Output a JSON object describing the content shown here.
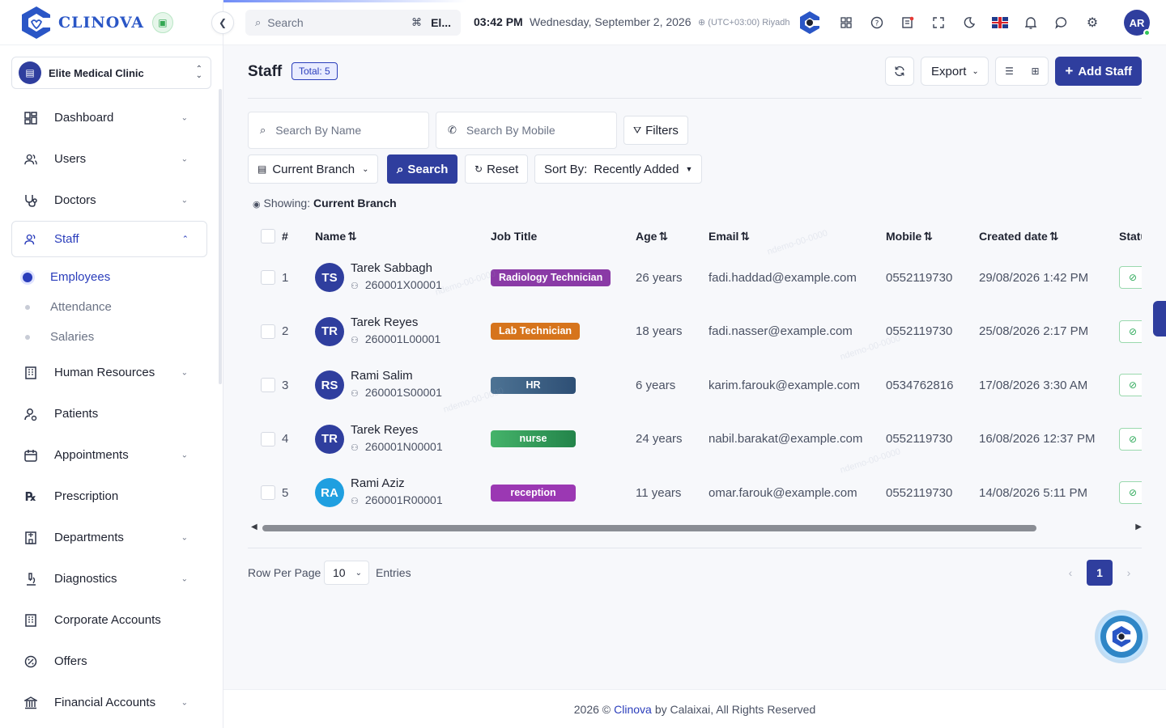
{
  "brand": {
    "name": "CLINOVA",
    "accent": "#2f3e9e"
  },
  "clinic": {
    "name": "Elite Medical Clinic"
  },
  "sidebar": {
    "items": [
      {
        "label": "Dashboard",
        "icon": "dashboard-icon",
        "chevron": true
      },
      {
        "label": "Users",
        "icon": "users-icon",
        "chevron": true
      },
      {
        "label": "Doctors",
        "icon": "stethoscope-icon",
        "chevron": true
      },
      {
        "label": "Staff",
        "icon": "staff-icon",
        "chevron": true,
        "active": true
      }
    ],
    "staff_sub": [
      "Employees",
      "Attendance",
      "Salaries"
    ],
    "items_after": [
      {
        "label": "Human Resources",
        "icon": "building-icon",
        "chevron": true
      },
      {
        "label": "Patients",
        "icon": "patient-icon",
        "chevron": false
      },
      {
        "label": "Appointments",
        "icon": "calendar-icon",
        "chevron": true
      },
      {
        "label": "Prescription",
        "icon": "prescription-icon",
        "chevron": false
      },
      {
        "label": "Departments",
        "icon": "department-icon",
        "chevron": true
      },
      {
        "label": "Diagnostics",
        "icon": "microscope-icon",
        "chevron": true
      },
      {
        "label": "Corporate Accounts",
        "icon": "corporate-icon",
        "chevron": false
      },
      {
        "label": "Offers",
        "icon": "offer-icon",
        "chevron": false
      },
      {
        "label": "Financial Accounts",
        "icon": "bank-icon",
        "chevron": true
      }
    ]
  },
  "topbar": {
    "search_placeholder": "Search",
    "shortcut": "⌘",
    "clinic_abbr": "El...",
    "time": "03:42 PM",
    "date": "Wednesday, September 2, 2026",
    "timezone": "(UTC+03:00) Riyadh",
    "user_initials": "AR"
  },
  "page": {
    "title": "Staff",
    "total": "Total: 5",
    "export_label": "Export",
    "add_label": "Add Staff"
  },
  "filters": {
    "name_placeholder": "Search By Name",
    "mobile_placeholder": "Search By Mobile",
    "filters_label": "Filters",
    "branch_label": "Current Branch",
    "search_label": "Search",
    "reset_label": "Reset",
    "sort_prefix": "Sort By:",
    "sort_value": "Recently Added",
    "showing_prefix": "Showing:",
    "showing_value": "Current Branch"
  },
  "table": {
    "columns": [
      "#",
      "Name",
      "Job Title",
      "Age",
      "Email",
      "Mobile",
      "Created date",
      "Status"
    ],
    "rows": [
      {
        "no": "1",
        "initials": "TS",
        "name": "Tarek Sabbagh",
        "id": "260001X00001",
        "job": "Radiology Technician",
        "job_color": "#8a3aa6",
        "age": "26 years",
        "email": "fadi.haddad@example.com",
        "mobile": "0552119730",
        "created": "29/08/2026 1:42 PM",
        "avatar_color": "#2f3e9e"
      },
      {
        "no": "2",
        "initials": "TR",
        "name": "Tarek Reyes",
        "id": "260001L00001",
        "job": "Lab Technician",
        "job_color": "#d6741c",
        "age": "18 years",
        "email": "fadi.nasser@example.com",
        "mobile": "0552119730",
        "created": "25/08/2026 2:17 PM",
        "avatar_color": "#2f3e9e"
      },
      {
        "no": "3",
        "initials": "RS",
        "name": "Rami Salim",
        "id": "260001S00001",
        "job": "HR",
        "job_color": "#4d7394",
        "age": "6 years",
        "email": "karim.farouk@example.com",
        "mobile": "0534762816",
        "created": "17/08/2026 3:30 AM",
        "avatar_color": "#2f3e9e"
      },
      {
        "no": "4",
        "initials": "TR",
        "name": "Tarek Reyes",
        "id": "260001N00001",
        "job": "nurse",
        "job_color": "#34a15a",
        "age": "24 years",
        "email": "nabil.barakat@example.com",
        "mobile": "0552119730",
        "created": "16/08/2026 12:37 PM",
        "avatar_color": "#2f3e9e"
      },
      {
        "no": "5",
        "initials": "RA",
        "name": "Rami Aziz",
        "id": "260001R00001",
        "job": "reception",
        "job_color": "#9b38b3",
        "age": "11 years",
        "email": "omar.farouk@example.com",
        "mobile": "0552119730",
        "created": "14/08/2026 5:11 PM",
        "avatar_color": "#1f9fe0"
      }
    ]
  },
  "pagination": {
    "rows_label": "Row Per Page",
    "rows_value": "10",
    "entries_label": "Entries",
    "current_page": "1"
  },
  "footer": {
    "prefix": "2026 ©",
    "brand": "Clinova",
    "suffix": "by Calaixai, All Rights Reserved"
  }
}
